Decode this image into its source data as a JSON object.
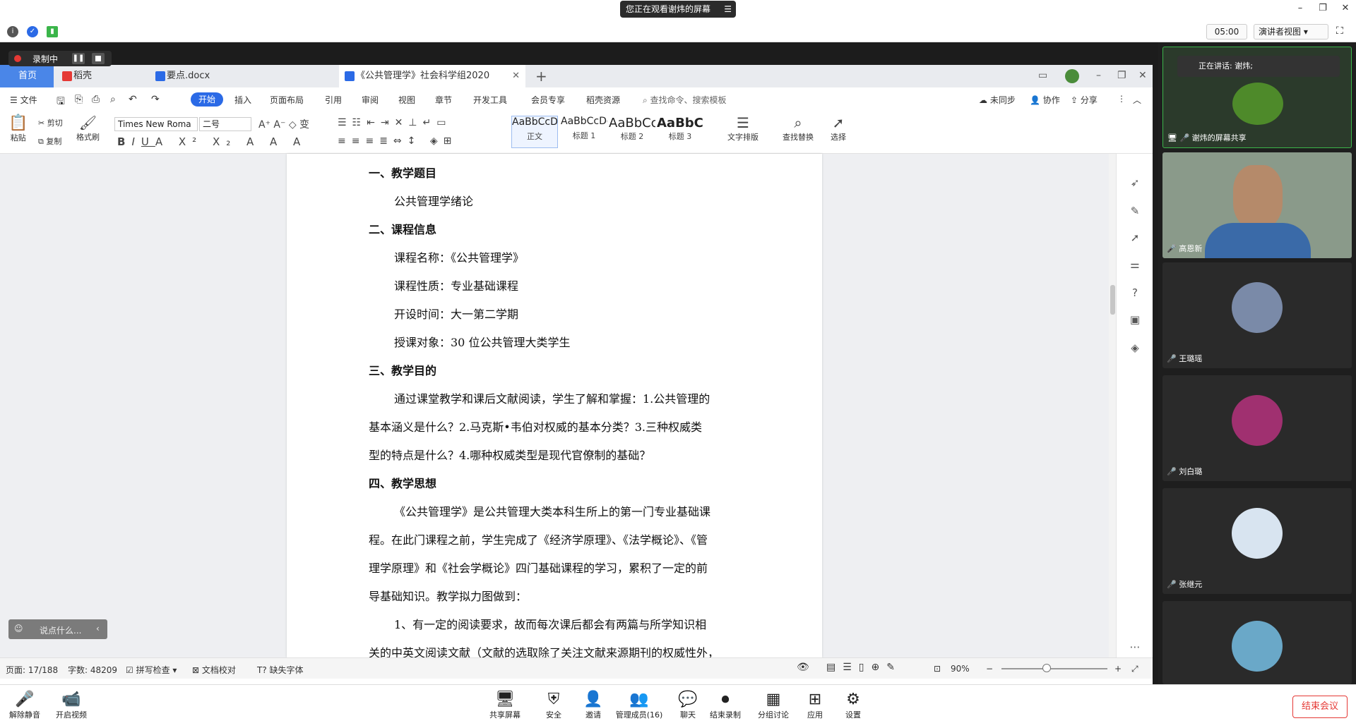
{
  "meeting": {
    "share_notice": "您正在观看谢炜的屏幕",
    "timer": "05:00",
    "speaker_view": "演讲者视图",
    "recording_label": "录制中",
    "end_meeting": "结束会议"
  },
  "wps": {
    "tabs": [
      {
        "label": "首页"
      },
      {
        "label": "稻壳"
      },
      {
        "label": "要点.docx"
      },
      {
        "label": "《公共管理学》社会科学组2020"
      }
    ],
    "menu": [
      "文件",
      "开始",
      "插入",
      "页面布局",
      "引用",
      "审阅",
      "视图",
      "章节",
      "开发工具",
      "会员专享",
      "稻壳资源"
    ],
    "search_placeholder": "查找命令、搜索模板",
    "sync": "未同步",
    "collab": "协作",
    "share": "分享",
    "ribbon": {
      "paste": "粘贴",
      "cut": "剪切",
      "copy": "复制",
      "format_painter": "格式刷",
      "font_name": "Times New Roma",
      "font_size": "二号",
      "styles": [
        {
          "sample": "AaBbCcDd",
          "name": "正文"
        },
        {
          "sample": "AaBbCcDc",
          "name": "标题 1"
        },
        {
          "sample": "AaBbCc",
          "name": "标题 2"
        },
        {
          "sample": "AaBbCc",
          "name": "标题 3"
        }
      ],
      "text_layout": "文字排版",
      "find_replace": "查找替换",
      "select": "选择"
    },
    "document_lines": [
      {
        "text": "一、教学题目",
        "heading": true
      },
      {
        "text": "公共管理学绪论",
        "indent": true
      },
      {
        "text": "二、课程信息",
        "heading": true
      },
      {
        "text": "课程名称：《公共管理学》",
        "indent": true
      },
      {
        "text": "课程性质：专业基础课程",
        "indent": true
      },
      {
        "text": "开设时间：大一第二学期",
        "indent": true
      },
      {
        "text": "授课对象：30 位公共管理大类学生",
        "indent": true
      },
      {
        "text": "三、教学目的",
        "heading": true
      },
      {
        "text": "通过课堂教学和课后文献阅读，学生了解和掌握：1.公共管理的",
        "indent": true
      },
      {
        "text": "基本涵义是什么？2.马克斯•韦伯对权威的基本分类？3.三种权威类"
      },
      {
        "text": "型的特点是什么？4.哪种权威类型是现代官僚制的基础？"
      },
      {
        "text": "四、教学思想",
        "heading": true
      },
      {
        "text": "《公共管理学》是公共管理大类本科生所上的第一门专业基础课",
        "indent": true
      },
      {
        "text": "程。在此门课程之前，学生完成了《经济学原理》、《法学概论》、《管"
      },
      {
        "text": "理学原理》和《社会学概论》四门基础课程的学习，累积了一定的前"
      },
      {
        "text": "导基础知识。教学拟力图做到："
      },
      {
        "text": "1、有一定的阅读要求，故而每次课后都会有两篇与所学知识相",
        "indent": true
      },
      {
        "text": "关的中英文阅读文献（文献的选取除了关注文献来源期刊的权威性外，"
      }
    ],
    "status": {
      "page": "页面: 17/188",
      "words": "字数: 48209",
      "spellcheck": "拼写检查",
      "proofread": "文档校对",
      "missing_font": "缺失字体",
      "zoom": "90%"
    },
    "chat_placeholder": "说点什么..."
  },
  "participants": [
    {
      "name": "谢炜的屏幕共享",
      "speaking_label": "正在讲话: 谢炜;"
    },
    {
      "name": "高恩新"
    },
    {
      "name": "王璐瑶"
    },
    {
      "name": "刘白璐"
    },
    {
      "name": "张继元"
    },
    {
      "name": ""
    }
  ],
  "toolbar": {
    "unmute": "解除静音",
    "start_video": "开启视频",
    "share_screen": "共享屏幕",
    "security": "安全",
    "invite": "邀请",
    "manage": "管理成员(16)",
    "chat": "聊天",
    "end_record": "结束录制",
    "breakout": "分组讨论",
    "apps": "应用",
    "settings": "设置"
  }
}
